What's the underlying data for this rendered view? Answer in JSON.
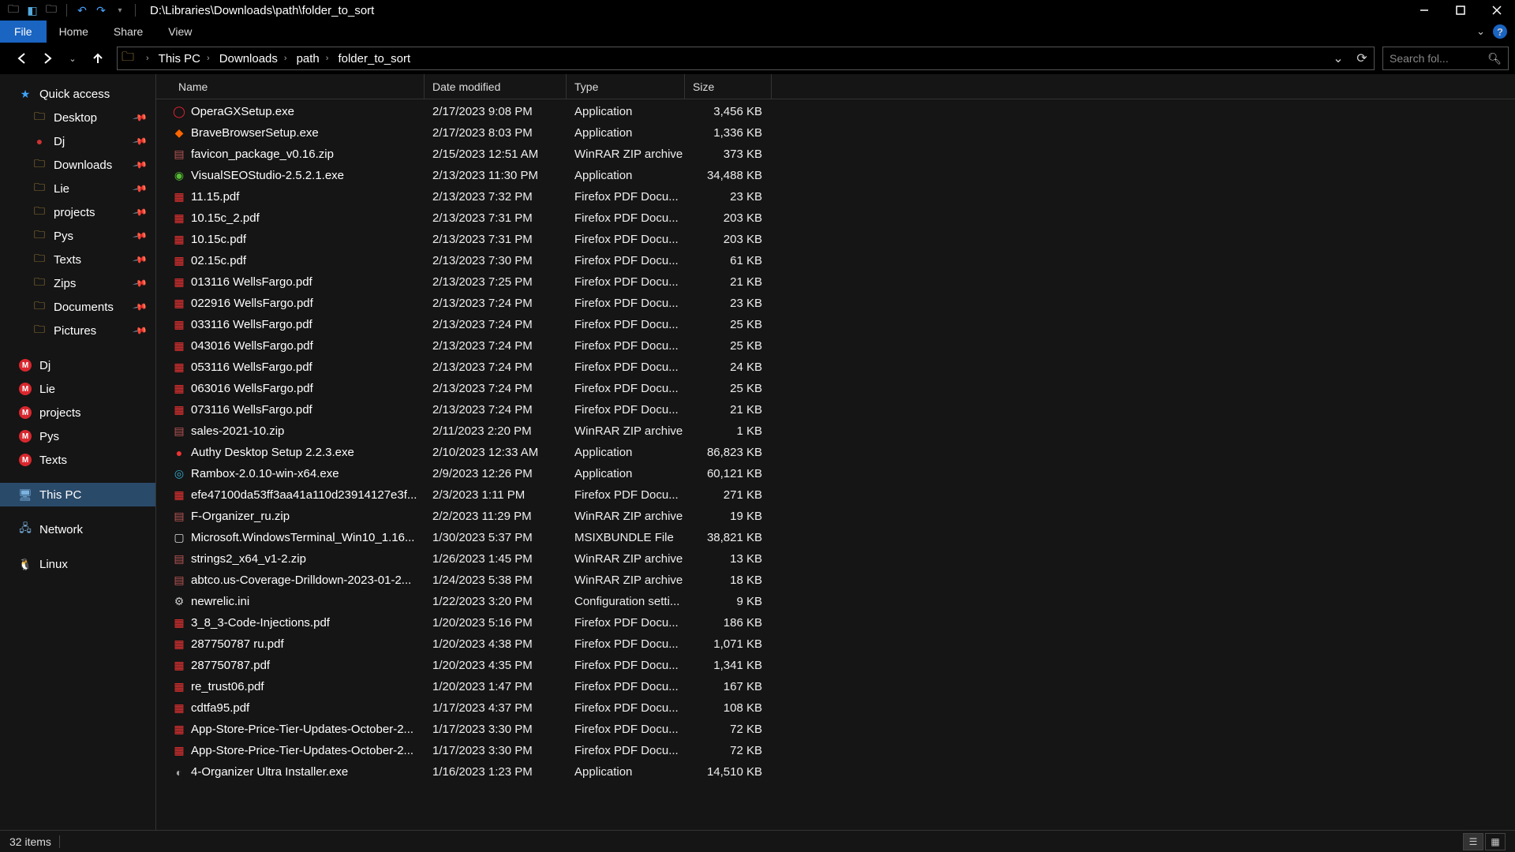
{
  "title_path": "D:\\Libraries\\Downloads\\path\\folder_to_sort",
  "ribbon": {
    "file": "File",
    "home": "Home",
    "share": "Share",
    "view": "View"
  },
  "breadcrumb": [
    {
      "label": "This PC"
    },
    {
      "label": "Downloads"
    },
    {
      "label": "path"
    },
    {
      "label": "folder_to_sort"
    }
  ],
  "search_placeholder": "Search fol...",
  "sidebar": {
    "quick_access": "Quick access",
    "pinned": [
      {
        "label": "Desktop",
        "icon": "folder-y"
      },
      {
        "label": "Dj",
        "icon": "dj"
      },
      {
        "label": "Downloads",
        "icon": "folder-y"
      },
      {
        "label": "Lie",
        "icon": "folder-y"
      },
      {
        "label": "projects",
        "icon": "folder-y"
      },
      {
        "label": "Pys",
        "icon": "folder-y"
      },
      {
        "label": "Texts",
        "icon": "folder-y"
      },
      {
        "label": "Zips",
        "icon": "folder-y"
      },
      {
        "label": "Documents",
        "icon": "folder-y"
      },
      {
        "label": "Pictures",
        "icon": "folder-y"
      }
    ],
    "mega": [
      {
        "label": "Dj"
      },
      {
        "label": "Lie"
      },
      {
        "label": "projects"
      },
      {
        "label": "Pys"
      },
      {
        "label": "Texts"
      }
    ],
    "this_pc": "This PC",
    "network": "Network",
    "linux": "Linux"
  },
  "columns": {
    "name": "Name",
    "date": "Date modified",
    "type": "Type",
    "size": "Size"
  },
  "files": [
    {
      "icon": "ic-exe-o",
      "name": "OperaGXSetup.exe",
      "date": "2/17/2023 9:08 PM",
      "type": "Application",
      "size": "3,456 KB"
    },
    {
      "icon": "ic-exe-b",
      "name": "BraveBrowserSetup.exe",
      "date": "2/17/2023 8:03 PM",
      "type": "Application",
      "size": "1,336 KB"
    },
    {
      "icon": "ic-zip",
      "name": "favicon_package_v0.16.zip",
      "date": "2/15/2023 12:51 AM",
      "type": "WinRAR ZIP archive",
      "size": "373 KB"
    },
    {
      "icon": "ic-exe-g",
      "name": "VisualSEOStudio-2.5.2.1.exe",
      "date": "2/13/2023 11:30 PM",
      "type": "Application",
      "size": "34,488 KB"
    },
    {
      "icon": "ic-pdf",
      "name": "11.15.pdf",
      "date": "2/13/2023 7:32 PM",
      "type": "Firefox PDF Docu...",
      "size": "23 KB"
    },
    {
      "icon": "ic-pdf",
      "name": "10.15c_2.pdf",
      "date": "2/13/2023 7:31 PM",
      "type": "Firefox PDF Docu...",
      "size": "203 KB"
    },
    {
      "icon": "ic-pdf",
      "name": "10.15c.pdf",
      "date": "2/13/2023 7:31 PM",
      "type": "Firefox PDF Docu...",
      "size": "203 KB"
    },
    {
      "icon": "ic-pdf",
      "name": "02.15c.pdf",
      "date": "2/13/2023 7:30 PM",
      "type": "Firefox PDF Docu...",
      "size": "61 KB"
    },
    {
      "icon": "ic-pdf",
      "name": "013116 WellsFargo.pdf",
      "date": "2/13/2023 7:25 PM",
      "type": "Firefox PDF Docu...",
      "size": "21 KB"
    },
    {
      "icon": "ic-pdf",
      "name": "022916 WellsFargo.pdf",
      "date": "2/13/2023 7:24 PM",
      "type": "Firefox PDF Docu...",
      "size": "23 KB"
    },
    {
      "icon": "ic-pdf",
      "name": "033116 WellsFargo.pdf",
      "date": "2/13/2023 7:24 PM",
      "type": "Firefox PDF Docu...",
      "size": "25 KB"
    },
    {
      "icon": "ic-pdf",
      "name": "043016 WellsFargo.pdf",
      "date": "2/13/2023 7:24 PM",
      "type": "Firefox PDF Docu...",
      "size": "25 KB"
    },
    {
      "icon": "ic-pdf",
      "name": "053116 WellsFargo.pdf",
      "date": "2/13/2023 7:24 PM",
      "type": "Firefox PDF Docu...",
      "size": "24 KB"
    },
    {
      "icon": "ic-pdf",
      "name": "063016 WellsFargo.pdf",
      "date": "2/13/2023 7:24 PM",
      "type": "Firefox PDF Docu...",
      "size": "25 KB"
    },
    {
      "icon": "ic-pdf",
      "name": "073116 WellsFargo.pdf",
      "date": "2/13/2023 7:24 PM",
      "type": "Firefox PDF Docu...",
      "size": "21 KB"
    },
    {
      "icon": "ic-zip",
      "name": "sales-2021-10.zip",
      "date": "2/11/2023 2:20 PM",
      "type": "WinRAR ZIP archive",
      "size": "1 KB"
    },
    {
      "icon": "ic-authy",
      "name": "Authy Desktop Setup 2.2.3.exe",
      "date": "2/10/2023 12:33 AM",
      "type": "Application",
      "size": "86,823 KB"
    },
    {
      "icon": "ic-rambox",
      "name": "Rambox-2.0.10-win-x64.exe",
      "date": "2/9/2023 12:26 PM",
      "type": "Application",
      "size": "60,121 KB"
    },
    {
      "icon": "ic-pdf",
      "name": "efe47100da53ff3aa41a110d23914127e3f...",
      "date": "2/3/2023 1:11 PM",
      "type": "Firefox PDF Docu...",
      "size": "271 KB"
    },
    {
      "icon": "ic-zip",
      "name": "F-Organizer_ru.zip",
      "date": "2/2/2023 11:29 PM",
      "type": "WinRAR ZIP archive",
      "size": "19 KB"
    },
    {
      "icon": "ic-bundle",
      "name": "Microsoft.WindowsTerminal_Win10_1.16...",
      "date": "1/30/2023 5:37 PM",
      "type": "MSIXBUNDLE File",
      "size": "38,821 KB"
    },
    {
      "icon": "ic-zip",
      "name": "strings2_x64_v1-2.zip",
      "date": "1/26/2023 1:45 PM",
      "type": "WinRAR ZIP archive",
      "size": "13 KB"
    },
    {
      "icon": "ic-zip",
      "name": "abtco.us-Coverage-Drilldown-2023-01-2...",
      "date": "1/24/2023 5:38 PM",
      "type": "WinRAR ZIP archive",
      "size": "18 KB"
    },
    {
      "icon": "ic-ini",
      "name": "newrelic.ini",
      "date": "1/22/2023 3:20 PM",
      "type": "Configuration setti...",
      "size": "9 KB"
    },
    {
      "icon": "ic-pdf",
      "name": "3_8_3-Code-Injections.pdf",
      "date": "1/20/2023 5:16 PM",
      "type": "Firefox PDF Docu...",
      "size": "186 KB"
    },
    {
      "icon": "ic-pdf",
      "name": "287750787 ru.pdf",
      "date": "1/20/2023 4:38 PM",
      "type": "Firefox PDF Docu...",
      "size": "1,071 KB"
    },
    {
      "icon": "ic-pdf",
      "name": "287750787.pdf",
      "date": "1/20/2023 4:35 PM",
      "type": "Firefox PDF Docu...",
      "size": "1,341 KB"
    },
    {
      "icon": "ic-pdf",
      "name": "re_trust06.pdf",
      "date": "1/20/2023 1:47 PM",
      "type": "Firefox PDF Docu...",
      "size": "167 KB"
    },
    {
      "icon": "ic-pdf",
      "name": "cdtfa95.pdf",
      "date": "1/17/2023 4:37 PM",
      "type": "Firefox PDF Docu...",
      "size": "108 KB"
    },
    {
      "icon": "ic-pdf",
      "name": "App-Store-Price-Tier-Updates-October-2...",
      "date": "1/17/2023 3:30 PM",
      "type": "Firefox PDF Docu...",
      "size": "72 KB"
    },
    {
      "icon": "ic-pdf",
      "name": "App-Store-Price-Tier-Updates-October-2...",
      "date": "1/17/2023 3:30 PM",
      "type": "Firefox PDF Docu...",
      "size": "72 KB"
    },
    {
      "icon": "ic-generic",
      "name": "4-Organizer Ultra Installer.exe",
      "date": "1/16/2023 1:23 PM",
      "type": "Application",
      "size": "14,510 KB"
    }
  ],
  "status": {
    "items": "32 items"
  }
}
